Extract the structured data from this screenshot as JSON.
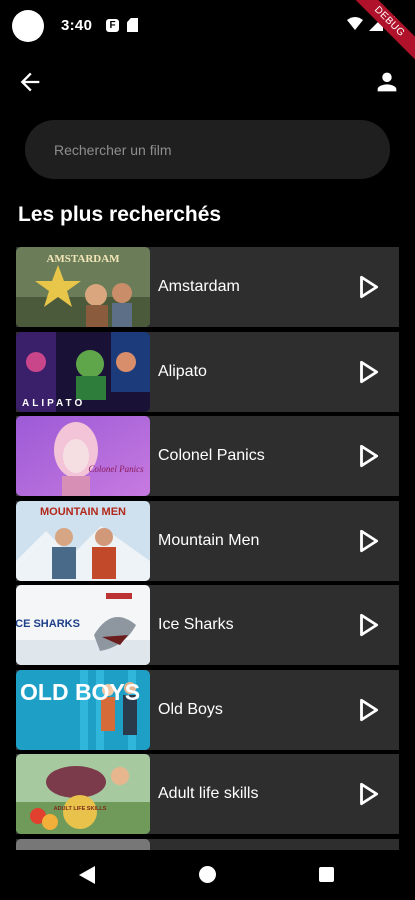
{
  "status_bar": {
    "time": "3:40",
    "icons": [
      "app-f-icon",
      "sd-card-icon",
      "wifi-icon",
      "signal-icon",
      "battery-icon"
    ],
    "debug_label": "DEBUG"
  },
  "app_bar": {
    "back_icon": "arrow-left-icon",
    "profile_icon": "person-icon"
  },
  "search": {
    "placeholder": "Rechercher un film",
    "value": ""
  },
  "section": {
    "title": "Les plus recherchés"
  },
  "movies": [
    {
      "title": "Amstardam",
      "poster_text": "AMSTARDAM"
    },
    {
      "title": "Alipato",
      "poster_text": "ALIPATO"
    },
    {
      "title": "Colonel Panics",
      "poster_text": "Colonel Panics"
    },
    {
      "title": "Mountain Men",
      "poster_text": "MOUNTAIN MEN"
    },
    {
      "title": "Ice Sharks",
      "poster_text": "ICE SHARKS"
    },
    {
      "title": "Old Boys",
      "poster_text": "OLD BOYS"
    },
    {
      "title": "Adult life skills",
      "poster_text": "ADULT LIFE SKILLS"
    }
  ],
  "colors": {
    "background": "#000000",
    "row": "#2e2e2e",
    "search_bg": "#1f1f1f",
    "debug": "#b0122b"
  },
  "nav_bar": {
    "icons": [
      "nav-back-icon",
      "nav-home-icon",
      "nav-recents-icon"
    ]
  }
}
